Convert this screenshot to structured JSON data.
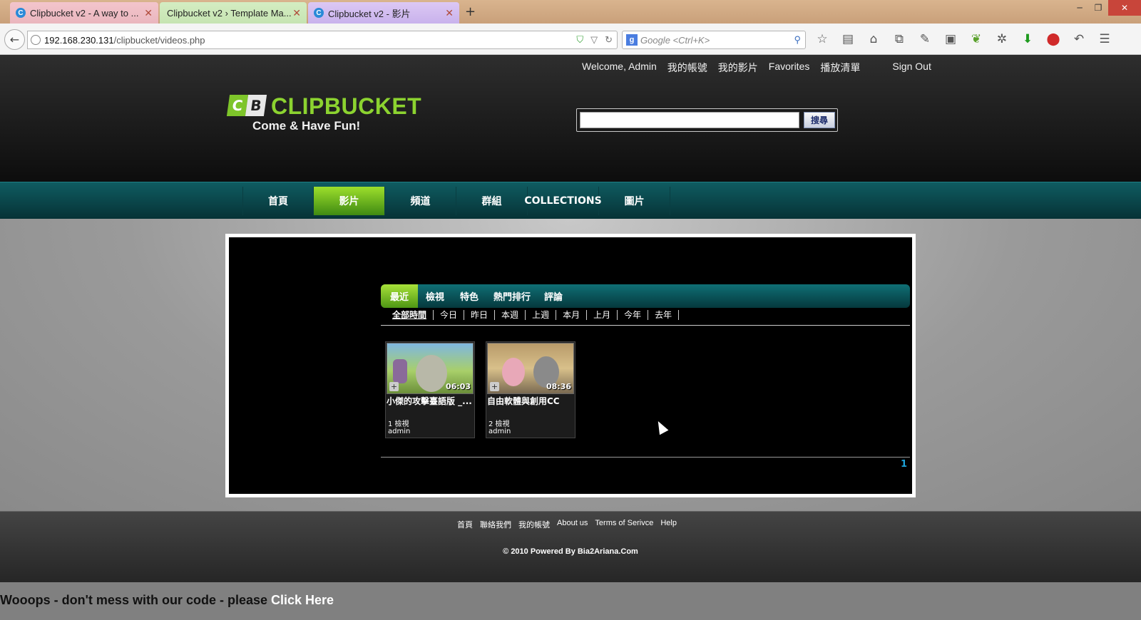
{
  "browser": {
    "tabs": [
      {
        "label": "Clipbucket v2 - A way to ..."
      },
      {
        "label": "Clipbucket v2 › Template Ma..."
      },
      {
        "label": "Clipbucket v2 - 影片"
      }
    ],
    "url_host": "192.168.230.131",
    "url_path": "/clipbucket/videos.php",
    "search_placeholder": "Google <Ctrl+K>"
  },
  "header": {
    "welcome": "Welcome, Admin",
    "links": [
      "我的帳號",
      "我的影片",
      "Favorites",
      "播放清單"
    ],
    "signout": "Sign Out",
    "logo_text": "CLIPBUCKET",
    "logo_slogan": "Come & Have Fun!",
    "search_button": "搜尋"
  },
  "nav": {
    "items": [
      "首頁",
      "影片",
      "頻道",
      "群組",
      "COLLECTIONS",
      "圖片"
    ],
    "active": "影片"
  },
  "video_tabs": [
    "最近",
    "檢視",
    "特色",
    "熱門排行",
    "評論"
  ],
  "time_filters": [
    "全部時間",
    "今日",
    "昨日",
    "本週",
    "上週",
    "本月",
    "上月",
    "今年",
    "去年"
  ],
  "videos": [
    {
      "title": "小傑的攻擊臺語版 _...",
      "duration": "06:03",
      "views": "1 檢視",
      "user": "admin"
    },
    {
      "title": "自由軟體與創用CC",
      "duration": "08:36",
      "views": "2 檢視",
      "user": "admin"
    }
  ],
  "pagination": {
    "current": "1"
  },
  "footer": {
    "links": [
      "首頁",
      "聯絡我們",
      "我的帳號",
      "About us",
      "Terms of Serivce",
      "Help"
    ],
    "copyright": "© 2010 Powered By Bia2Ariana.Com"
  },
  "warning": {
    "text": "Wooops - don't mess with our code - please ",
    "link": "Click Here"
  },
  "colors": {
    "accent_green": "#8cd330",
    "nav_teal": "#0f5c61",
    "page_link_blue": "#1da2d8"
  }
}
